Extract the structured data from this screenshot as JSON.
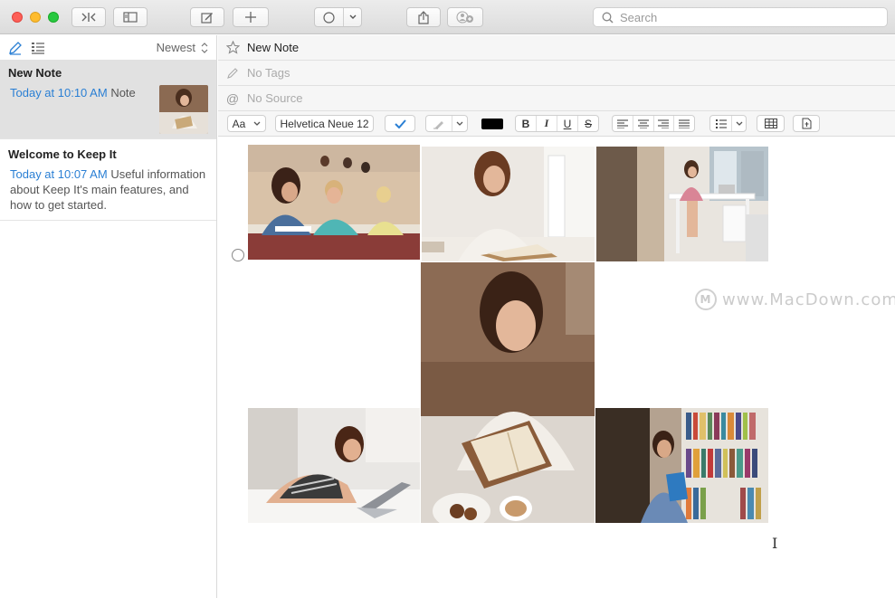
{
  "toolbar": {
    "search_placeholder": "Search",
    "icons": [
      "sidebar-toggle-icon",
      "layout-icon",
      "compose-icon",
      "plus-icon",
      "circle-icon",
      "chevron-down-icon",
      "share-icon",
      "add-person-icon",
      "search-icon"
    ]
  },
  "sidebar": {
    "sort_label": "Newest",
    "notes": [
      {
        "title": "New Note",
        "date": "Today at 10:10 AM",
        "preview": "Note"
      },
      {
        "title": "Welcome to Keep It",
        "date": "Today at 10:07 AM",
        "preview": "Useful information about Keep It's main features, and how to get started."
      }
    ]
  },
  "note": {
    "title": "New Note",
    "tags_placeholder": "No Tags",
    "source_placeholder": "No Source"
  },
  "format": {
    "style_label": "Aa",
    "font_label": "Helvetica Neue 12",
    "text_color": "#000000",
    "bold": "B",
    "italic": "I",
    "underline": "U",
    "strike": "S"
  },
  "watermark": {
    "text": "www.MacDown.com",
    "logo": "M"
  },
  "colors": {
    "accent": "#2a7fd4",
    "selected_row": "#e1e1e1"
  }
}
